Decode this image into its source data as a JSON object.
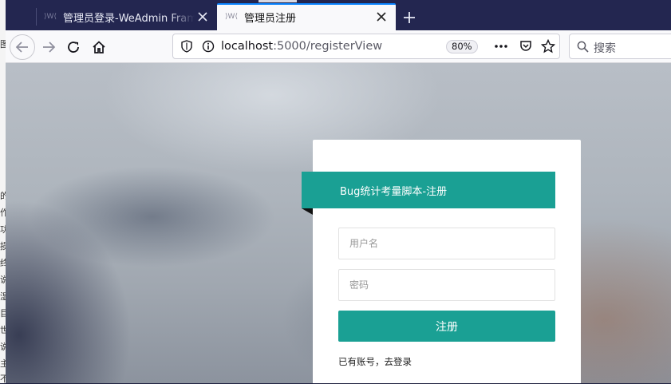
{
  "tabs": [
    {
      "title": "管理员登录-WeAdmin Frame",
      "active": false
    },
    {
      "title": "管理员注册",
      "active": true
    }
  ],
  "navbar": {
    "url_host": "localhost",
    "url_path": ":5000/registerView",
    "zoom": "80%",
    "search_placeholder": "搜索"
  },
  "register": {
    "ribbon_title": "Bug统计考量脚本-注册",
    "username_placeholder": "用户名",
    "password_placeholder": "密码",
    "submit_label": "注册",
    "login_link": "已有账号，去登录"
  },
  "left_strip_chars": [
    "图",
    "的",
    "作",
    "功",
    "损",
    "终",
    "说",
    "湿",
    "目",
    "世",
    "说",
    "主",
    "不"
  ],
  "colors": {
    "accent": "#1aa094",
    "tabbar": "#232650",
    "focus": "#0a84ff"
  }
}
